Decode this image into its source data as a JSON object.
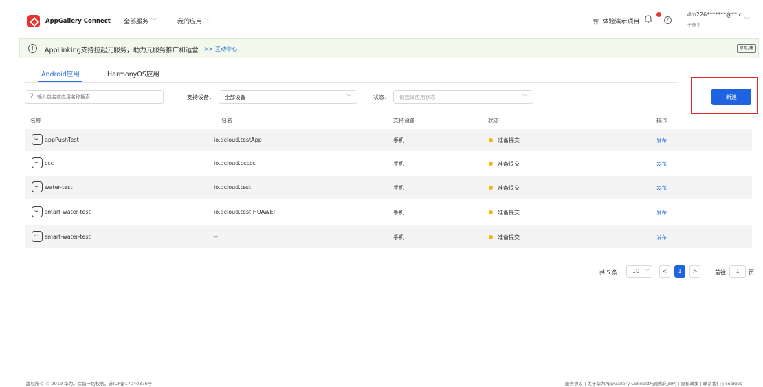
{
  "header": {
    "brand": "AppGallery Connect",
    "nav": [
      {
        "label": "全部服务"
      },
      {
        "label": "我的应用"
      }
    ],
    "demo_project": "体验演示项目",
    "help": "?",
    "user_email": "dm226*******@**.c...",
    "user_sub": "子账平"
  },
  "notice": {
    "text": "AppLinking支持拉起元服务，助力元服务推广和运营",
    "link": ">> 互动中心",
    "feedback": "意见/建",
    "close": "×"
  },
  "tabs": [
    {
      "label": "Android应用",
      "active": true
    },
    {
      "label": "HarmonyOS应用",
      "active": false
    }
  ],
  "filters": {
    "search_placeholder": "输入包名或应用名称搜索",
    "device_label": "支持设备：",
    "device_value": "全部设备",
    "status_label": "状态：",
    "status_placeholder": "请选择应用状态",
    "new_button": "新建"
  },
  "table": {
    "columns": [
      "名称",
      "包名",
      "支持设备",
      "状态",
      "操作"
    ],
    "rows": [
      {
        "name": "appPushTest",
        "package": "io.dcloud.testApp",
        "device": "手机",
        "status": "准备提交",
        "action": "发布"
      },
      {
        "name": "ccc",
        "package": "io.dcloud.ccccc",
        "device": "手机",
        "status": "准备提交",
        "action": "发布"
      },
      {
        "name": "water-test",
        "package": "io.dcloud.test",
        "device": "手机",
        "status": "准备提交",
        "action": "发布"
      },
      {
        "name": "smart-water-test",
        "package": "io.dcloud.test.HUAWEI",
        "device": "手机",
        "status": "准备提交",
        "action": "发布"
      },
      {
        "name": "smart-water-test",
        "package": "--",
        "device": "手机",
        "status": "准备提交",
        "action": "发布"
      }
    ]
  },
  "pagination": {
    "total": "共 5 条",
    "page_size": "10",
    "prev": "<",
    "current": "1",
    "next": ">",
    "goto_label": "前往",
    "goto_value": "1",
    "page_suffix": "页"
  },
  "footer": {
    "left": "版权所有 © 2019 华为。保留一切权利。苏ICP备17040376号",
    "right": "服务协议 | 关于华为AppGallery Connect与隐私的声明 | 隐私政策 | 联系我们 | cookies"
  },
  "colors": {
    "accent": "#1e64e0",
    "link": "#2a72d8",
    "status_pending": "#f5b400",
    "highlight_frame": "#e02a2a",
    "brand": "#e8342c"
  }
}
